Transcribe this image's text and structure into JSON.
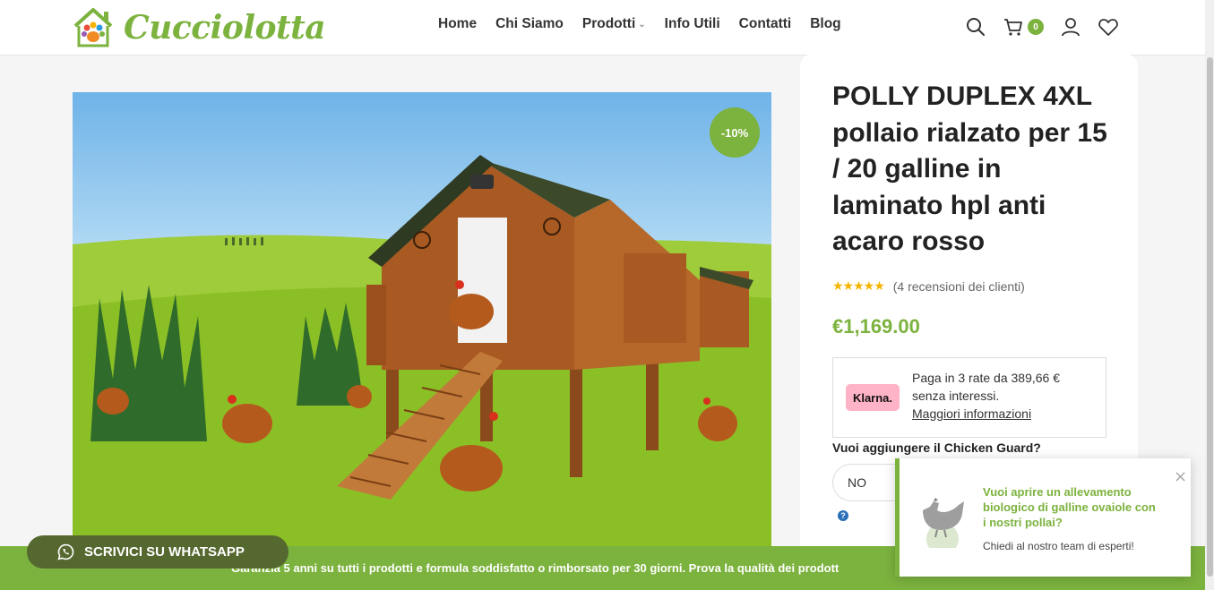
{
  "header": {
    "logo_text": "Cucciolotta",
    "nav": [
      {
        "label": "Home"
      },
      {
        "label": "Chi Siamo"
      },
      {
        "label": "Prodotti"
      },
      {
        "label": "Info Utili"
      },
      {
        "label": "Contatti"
      },
      {
        "label": "Blog"
      }
    ],
    "cart_count": "0",
    "icons": [
      "search-icon",
      "cart-icon",
      "user-icon",
      "heart-icon"
    ]
  },
  "product": {
    "sale_badge": "-10%",
    "title": "POLLY DUPLEX 4XL pollaio rialzato per 15 / 20 galline in laminato hpl anti acaro rosso",
    "rating": 5,
    "reviews_text": "(4 recensioni dei clienti)",
    "price": "€1,169.00"
  },
  "klarna": {
    "logo": "Klarna.",
    "text": "Paga in 3 rate da 389,66 € senza interessi.",
    "link": "Maggiori informazioni"
  },
  "options": {
    "guard_label": "Vuoi aggiungere il Chicken Guard?",
    "guard_value": "NO",
    "help": "?"
  },
  "footer": {
    "guarantee": "Garanzia 5 anni su tutti i prodotti e formula soddisfatto o rimborsato per 30 giorni. Prova la qualità dei prodott",
    "whatsapp": "SCRIVICI SU WHATSAPP"
  },
  "popup": {
    "title": "Vuoi aprire un allevamento biologico di galline ovaiole con i nostri pollai?",
    "subtitle": "Chiedi al nostro team di esperti!",
    "close": "×"
  },
  "colors": {
    "brand_green": "#7cb23e",
    "whatsapp_bg": "#55682f",
    "klarna_pink": "#ffb3c7",
    "star": "#f5b400"
  }
}
